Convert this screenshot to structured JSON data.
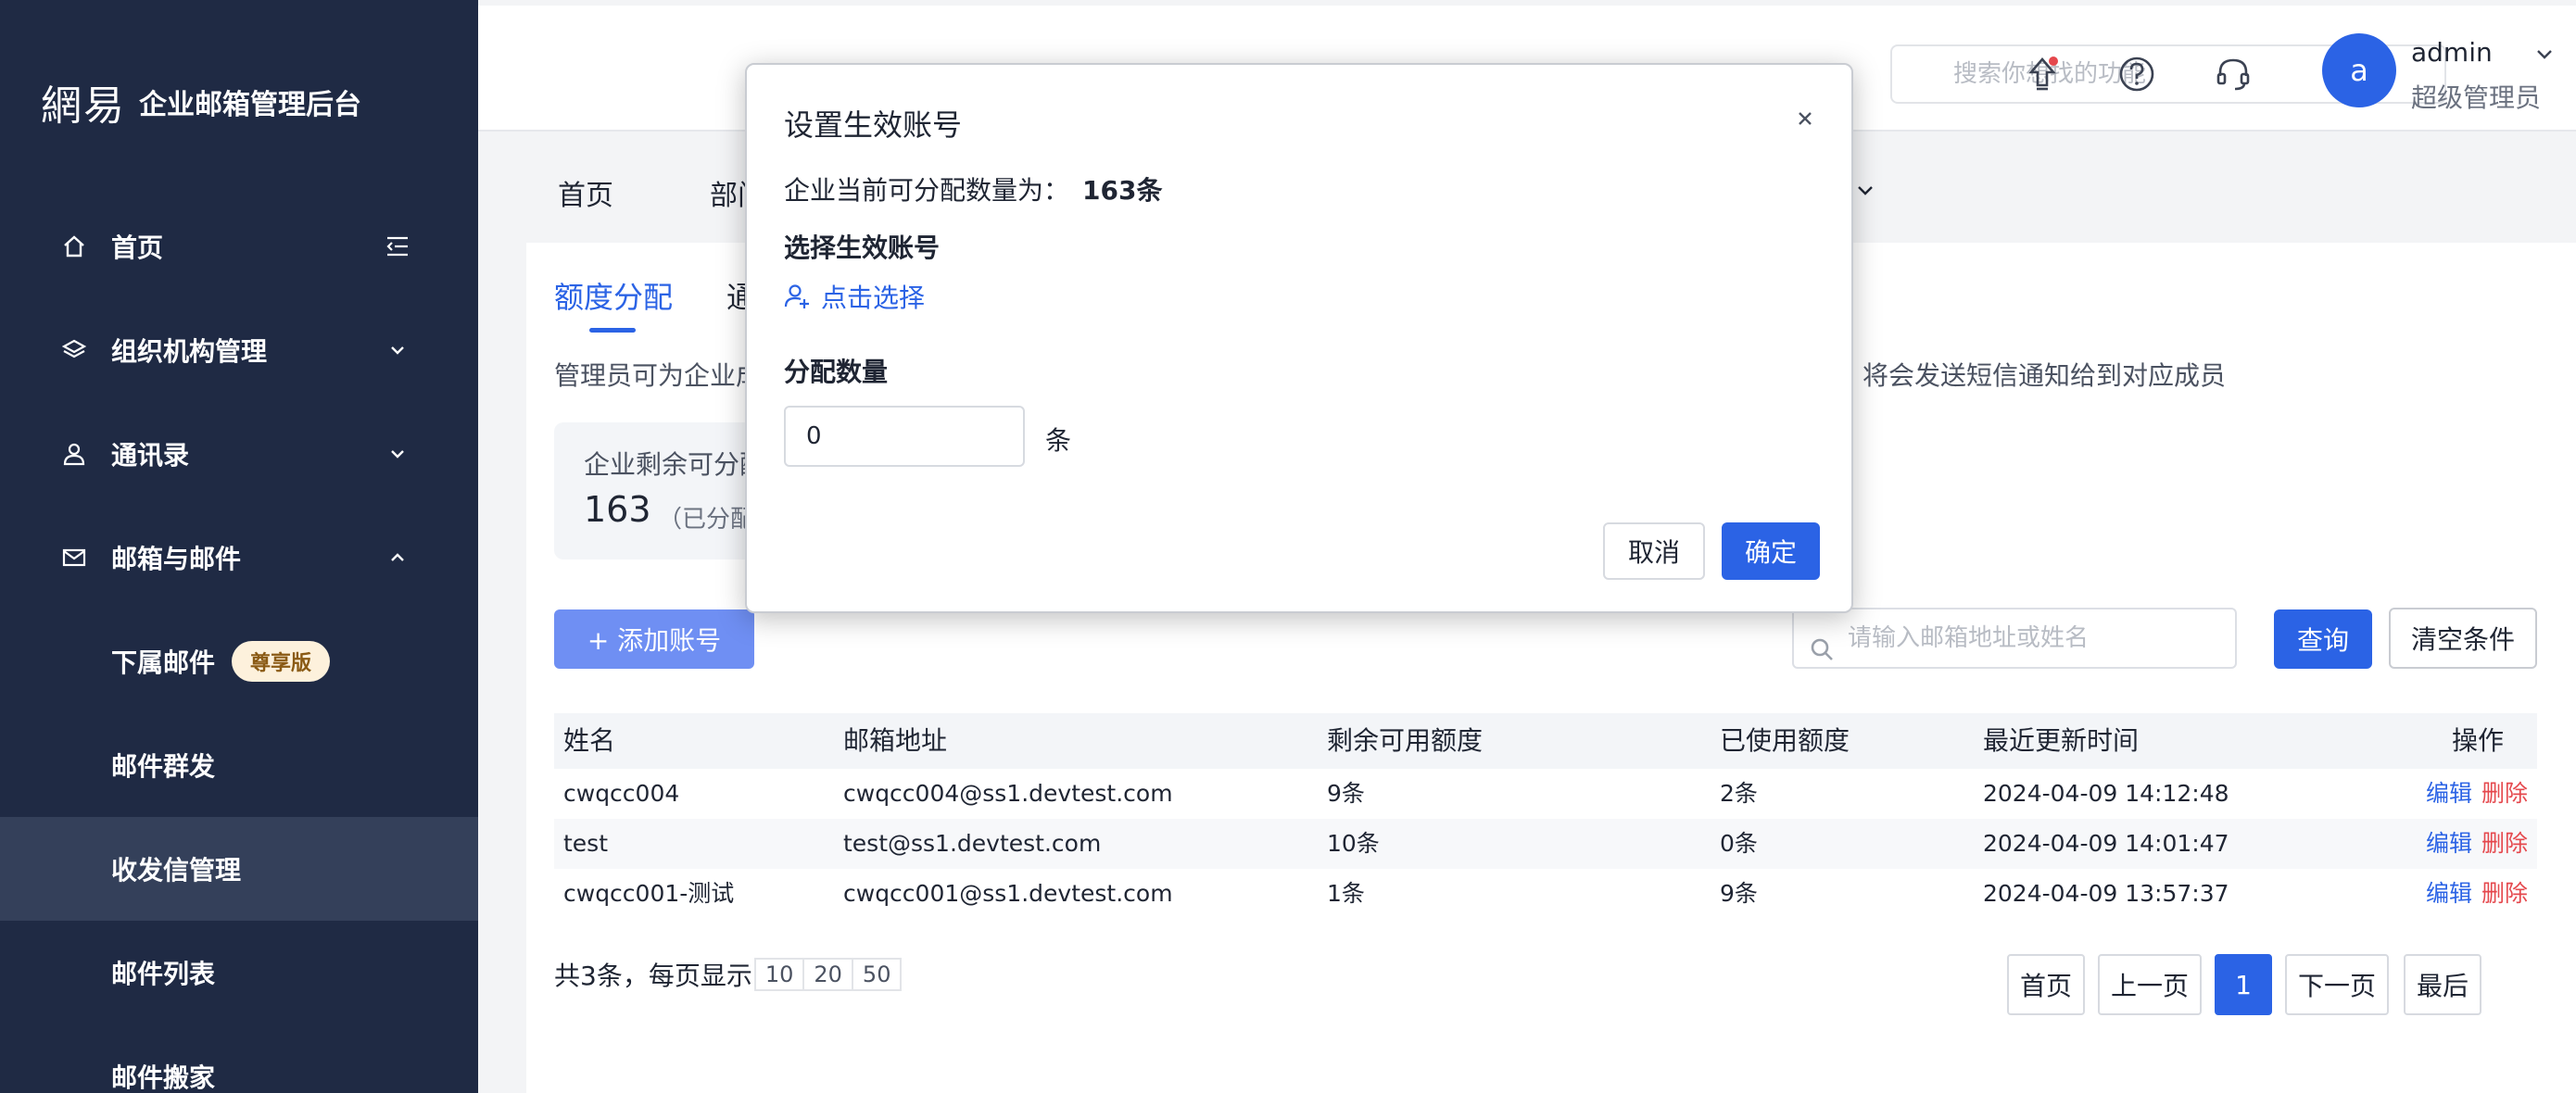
{
  "app": {
    "logo_mark": "網易",
    "logo_text": "企业邮箱管理后台"
  },
  "sidebar": {
    "items": [
      {
        "label": "首页",
        "icon": "home-icon"
      },
      {
        "label": "组织机构管理",
        "icon": "layers-icon"
      },
      {
        "label": "通讯录",
        "icon": "user-icon"
      },
      {
        "label": "邮箱与邮件",
        "icon": "mail-icon"
      }
    ],
    "sub_items": [
      {
        "label": "下属邮件",
        "badge": "尊享版"
      },
      {
        "label": "邮件群发"
      },
      {
        "label": "收发信管理"
      },
      {
        "label": "邮件列表"
      },
      {
        "label": "邮件搬家"
      }
    ]
  },
  "header": {
    "search_placeholder": "搜索你想找的功能",
    "avatar_letter": "a",
    "user_name": "admin",
    "user_role": "超级管理员"
  },
  "topnav": {
    "tabs": [
      "首页",
      "部门"
    ]
  },
  "page": {
    "subtabs": [
      "额度分配",
      "通"
    ],
    "desc_left": "管理员可为企业成",
    "desc_right": "件，将会发送短信通知给到对应成员",
    "quota_label": "企业剩余可分配",
    "quota_value": "163",
    "quota_note": "（已分配",
    "add_button": "+ 添加账号",
    "search_placeholder": "请输入邮箱地址或姓名",
    "query_button": "查询",
    "clear_button": "清空条件"
  },
  "table": {
    "columns": [
      "姓名",
      "邮箱地址",
      "剩余可用额度",
      "已使用额度",
      "最近更新时间",
      "操作"
    ],
    "rows": [
      {
        "name": "cwqcc004",
        "email": "cwqcc004@ss1.devtest.com",
        "remaining": "9条",
        "used": "2条",
        "updated": "2024-04-09 14:12:48"
      },
      {
        "name": "test",
        "email": "test@ss1.devtest.com",
        "remaining": "10条",
        "used": "0条",
        "updated": "2024-04-09 14:01:47"
      },
      {
        "name": "cwqcc001-测试",
        "email": "cwqcc001@ss1.devtest.com",
        "remaining": "1条",
        "used": "9条",
        "updated": "2024-04-09 13:57:37"
      }
    ],
    "edit_label": "编辑",
    "delete_label": "删除"
  },
  "pager": {
    "summary": "共3条，每页显示",
    "sizes": [
      "10",
      "20",
      "50"
    ],
    "first": "首页",
    "prev": "上一页",
    "current": "1",
    "next": "下一页",
    "last": "最后"
  },
  "modal": {
    "title": "设置生效账号",
    "quota_text": "企业当前可分配数量为：",
    "quota_value": "163条",
    "select_label": "选择生效账号",
    "pick_link": "点击选择",
    "qty_label": "分配数量",
    "qty_value": "0",
    "unit": "条",
    "cancel": "取消",
    "confirm": "确定"
  },
  "colors": {
    "sidebar_bg": "#1f2a44",
    "primary": "#2b63e5",
    "danger": "#e5484d"
  }
}
